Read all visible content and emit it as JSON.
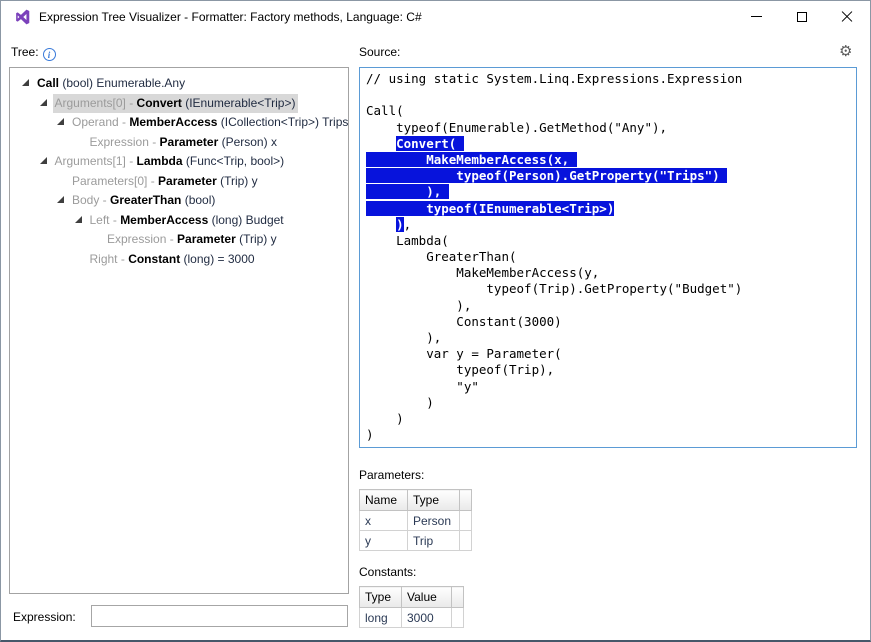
{
  "window": {
    "title": "Expression Tree Visualizer - Formatter: Factory methods, Language: C#"
  },
  "icons": {
    "info_glyph": "i",
    "gear_glyph": "⚙"
  },
  "colors": {
    "selection_blue": "#0713dc",
    "tree_selection_gray": "#d8d8d8",
    "source_border_blue": "#5b9bd5",
    "vs_logo_purple": "#7b41bb"
  },
  "tree": {
    "label": "Tree:",
    "items": [
      {
        "level": 0,
        "expander": true,
        "selected": false,
        "prefix": "",
        "name": "Call",
        "type": "(bool)",
        "extra": "Enumerable.Any"
      },
      {
        "level": 1,
        "expander": true,
        "selected": true,
        "prefix": "Arguments[0] - ",
        "name": "Convert",
        "type": "(IEnumerable<Trip>)",
        "extra": ""
      },
      {
        "level": 2,
        "expander": true,
        "selected": false,
        "prefix": "Operand - ",
        "name": "MemberAccess",
        "type": "(ICollection<Trip>)",
        "extra": "Trips"
      },
      {
        "level": 3,
        "expander": false,
        "selected": false,
        "prefix": "Expression - ",
        "name": "Parameter",
        "type": "(Person)",
        "extra": "x"
      },
      {
        "level": 1,
        "expander": true,
        "selected": false,
        "prefix": "Arguments[1] - ",
        "name": "Lambda",
        "type": "(Func<Trip, bool>)",
        "extra": ""
      },
      {
        "level": 2,
        "expander": false,
        "selected": false,
        "prefix": "Parameters[0] - ",
        "name": "Parameter",
        "type": "(Trip)",
        "extra": "y"
      },
      {
        "level": 2,
        "expander": true,
        "selected": false,
        "prefix": "Body - ",
        "name": "GreaterThan",
        "type": "(bool)",
        "extra": ""
      },
      {
        "level": 3,
        "expander": true,
        "selected": false,
        "prefix": "Left - ",
        "name": "MemberAccess",
        "type": "(long)",
        "extra": "Budget"
      },
      {
        "level": 4,
        "expander": false,
        "selected": false,
        "prefix": "Expression - ",
        "name": "Parameter",
        "type": "(Trip)",
        "extra": "y"
      },
      {
        "level": 3,
        "expander": false,
        "selected": false,
        "prefix": "Right - ",
        "name": "Constant",
        "type": "(long)",
        "extra": "= 3000"
      }
    ]
  },
  "source": {
    "label": "Source:",
    "lines": [
      [
        {
          "t": "// using static System.Linq.Expressions.Expression"
        }
      ],
      [],
      [
        {
          "t": "Call("
        }
      ],
      [
        {
          "t": "    typeof(Enumerable).GetMethod(\"Any\"),"
        }
      ],
      [
        {
          "t": "    "
        },
        {
          "t": "Convert( ",
          "sel": true
        }
      ],
      [
        {
          "t": "        MakeMemberAccess(x, ",
          "sel": true
        }
      ],
      [
        {
          "t": "            typeof(Person).GetProperty(\"Trips\") ",
          "sel": true
        }
      ],
      [
        {
          "t": "        ), ",
          "sel": true
        }
      ],
      [
        {
          "t": "        typeof(IEnumerable<Trip>)",
          "sel": true
        }
      ],
      [
        {
          "t": "    "
        },
        {
          "t": ")",
          "sel": true
        },
        {
          "t": ","
        }
      ],
      [
        {
          "t": "    Lambda("
        }
      ],
      [
        {
          "t": "        GreaterThan("
        }
      ],
      [
        {
          "t": "            MakeMemberAccess(y,"
        }
      ],
      [
        {
          "t": "                typeof(Trip).GetProperty(\"Budget\")"
        }
      ],
      [
        {
          "t": "            ),"
        }
      ],
      [
        {
          "t": "            Constant(3000)"
        }
      ],
      [
        {
          "t": "        ),"
        }
      ],
      [
        {
          "t": "        var y = Parameter("
        }
      ],
      [
        {
          "t": "            typeof(Trip),"
        }
      ],
      [
        {
          "t": "            \"y\""
        }
      ],
      [
        {
          "t": "        )"
        }
      ],
      [
        {
          "t": "    )"
        }
      ],
      [
        {
          "t": ")"
        }
      ]
    ]
  },
  "parameters": {
    "label": "Parameters:",
    "headers": [
      "Name",
      "Type"
    ],
    "rows": [
      [
        "x",
        "Person"
      ],
      [
        "y",
        "Trip"
      ]
    ]
  },
  "constants": {
    "label": "Constants:",
    "headers": [
      "Type",
      "Value"
    ],
    "rows": [
      [
        "long",
        "3000"
      ]
    ]
  },
  "expression": {
    "label": "Expression:",
    "value": ""
  }
}
